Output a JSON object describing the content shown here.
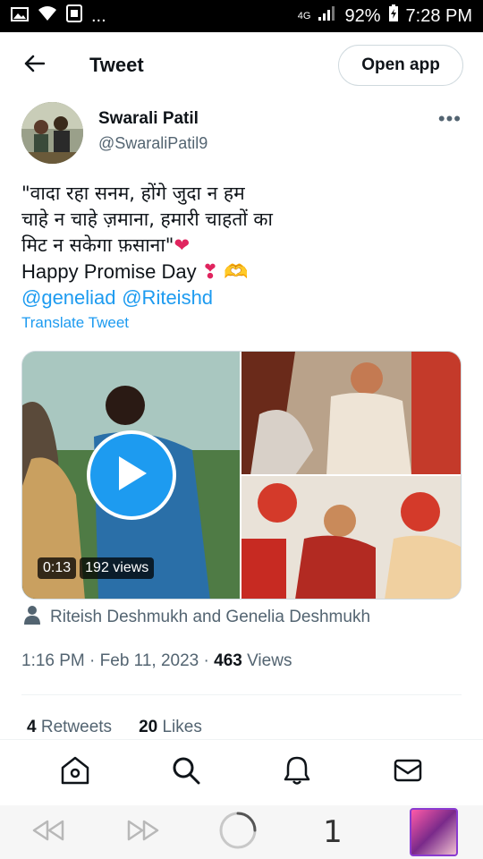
{
  "status": {
    "signal_label": "4G",
    "battery": "92%",
    "time": "7:28 PM",
    "ellipsis": "..."
  },
  "header": {
    "title": "Tweet",
    "open_app": "Open app"
  },
  "author": {
    "name": "Swarali Patil",
    "handle": "@SwaraliPatil9",
    "more": "•••"
  },
  "tweet": {
    "line1": "\"वादा रहा सनम, होंगे जुदा न हम",
    "line2": "चाहे न चाहे ज़माना, हमारी चाहतों का",
    "line3": "मिट न सकेगा फ़साना\"",
    "heart": "❤",
    "line4": "Happy Promise Day ",
    "emojis": "❣ 🫶",
    "mention1": "@geneliad",
    "mention2": "@Riteishd",
    "translate": "Translate Tweet"
  },
  "media": {
    "duration": "0:13",
    "views": "192 views"
  },
  "tagged": "Riteish Deshmukh and Genelia Deshmukh",
  "meta": {
    "time": "1:16 PM",
    "sep1": " · ",
    "date": "Feb 11, 2023",
    "sep2": " · ",
    "views_count": "463",
    "views_label": " Views"
  },
  "stats": {
    "retweets_count": "4",
    "retweets_label": " Retweets",
    "likes_count": "20",
    "likes_label": " Likes"
  },
  "browser": {
    "tab_count": "1"
  },
  "colors": {
    "accent": "#1d9bf0",
    "text": "#0f1419",
    "muted": "#536471",
    "heart": "#e0245e"
  }
}
